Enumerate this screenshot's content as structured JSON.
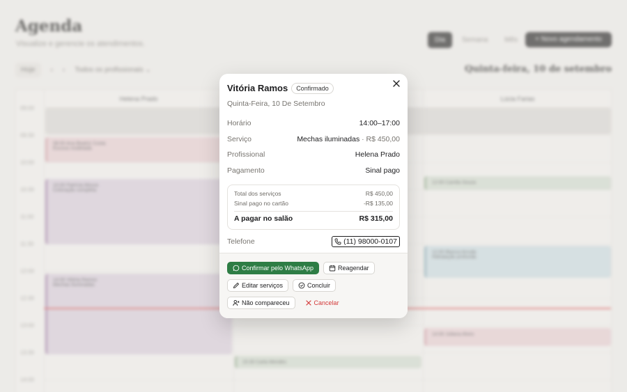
{
  "background": {
    "title": "Agenda",
    "subtitle": "Visualize e gerencie os atendimentos.",
    "view_tabs": [
      "Dia",
      "Semana",
      "Mês"
    ],
    "new_button": "+ Novo agendamento",
    "toolbar": {
      "today": "Hoje",
      "prev": "‹",
      "next": "›",
      "filter": "Todos os profissionais ⌄"
    },
    "current_date": "Quinta-feira, 10 de setembro",
    "columns": [
      "Helena Prado",
      "",
      "Lúcia Farias"
    ],
    "times": [
      "09:00",
      "09:30",
      "10:00",
      "10:30",
      "11:00",
      "11:30",
      "12:00",
      "12:30",
      "13:00",
      "13:30",
      "14:00"
    ],
    "events": [
      {
        "label": "08:00 Ana Beatriz Costa",
        "sub": "Escova modelada"
      },
      {
        "label": "10:00 Patrícia Moura",
        "sub": "Coloração completa"
      },
      {
        "label": "12:00 Camila Souza",
        "sub": ""
      },
      {
        "label": "12:00 Bianca Arruda",
        "sub": "Hidratação profunda"
      },
      {
        "label": "14:00 Vitória Ramos",
        "sub": "Mechas iluminadas"
      },
      {
        "label": "14:00 Juliana Alves",
        "sub": "Manicure"
      },
      {
        "label": "15:30 Carla Mendes",
        "sub": ""
      }
    ]
  },
  "modal": {
    "client_name": "Vitória Ramos",
    "status": "Confirmado",
    "date": "Quinta-Feira, 10 De Setembro",
    "close_icon": "close-icon",
    "details": [
      {
        "label": "Horário",
        "value": "14:00–17:00",
        "extra": ""
      },
      {
        "label": "Serviço",
        "value": "Mechas iluminadas",
        "extra": " · R$ 450,00"
      },
      {
        "label": "Profissional",
        "value": "Helena Prado",
        "extra": ""
      },
      {
        "label": "Pagamento",
        "value": "Sinal pago",
        "extra": ""
      }
    ],
    "totals": {
      "services_label": "Total dos serviços",
      "services_value": "R$ 450,00",
      "deposit_label": "Sinal pago no cartão",
      "deposit_value": "-R$ 135,00",
      "due_label": "A pagar no salão",
      "due_value": "R$ 315,00"
    },
    "phone_label": "Telefone",
    "phone_value": "(11) 98000-0107",
    "actions": {
      "whatsapp": "Confirmar pelo WhatsApp",
      "reschedule": "Reagendar",
      "edit_services": "Editar serviços",
      "complete": "Concluir",
      "no_show": "Não compareceu",
      "cancel": "Cancelar"
    },
    "colors": {
      "primary": "#2e7d45",
      "danger": "#d33a3a",
      "now_line": "#e05a5a"
    }
  }
}
